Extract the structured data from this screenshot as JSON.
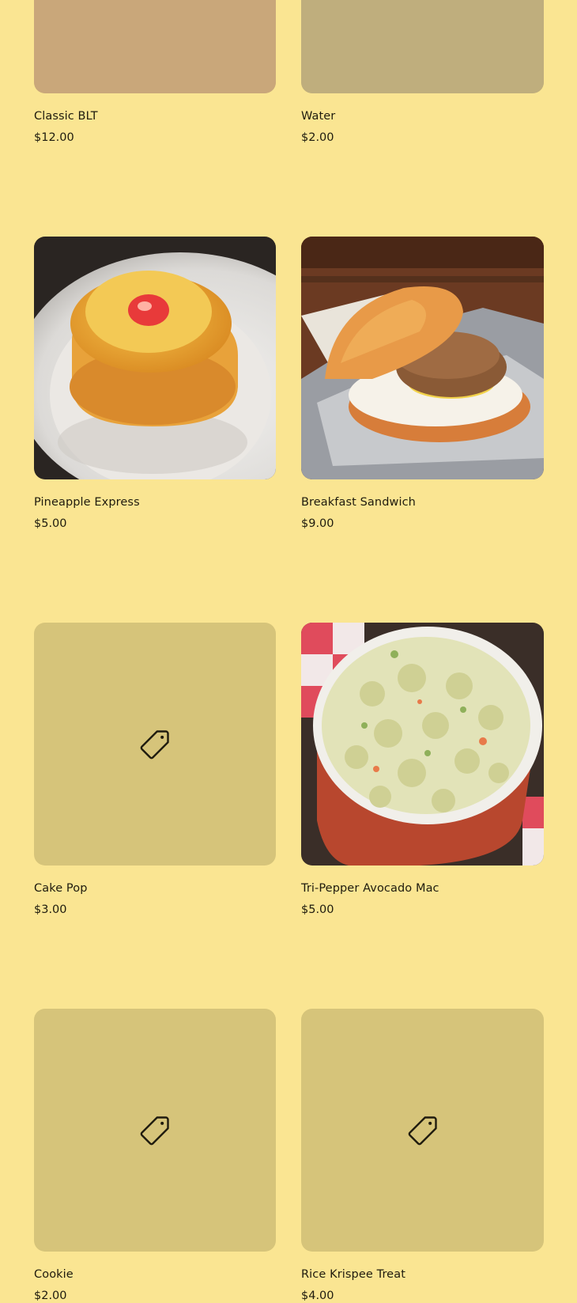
{
  "products": [
    {
      "name": "Classic BLT",
      "price": "$12.00",
      "image": "photo-classic-blt"
    },
    {
      "name": "Water",
      "price": "$2.00",
      "image": "photo-water"
    },
    {
      "name": "Pineapple Express",
      "price": "$5.00",
      "image": "photo-pineapple-cake"
    },
    {
      "name": "Breakfast Sandwich",
      "price": "$9.00",
      "image": "photo-breakfast-sandwich"
    },
    {
      "name": "Cake Pop",
      "price": "$3.00",
      "image": "price-tag-icon"
    },
    {
      "name": "Tri-Pepper Avocado Mac",
      "price": "$5.00",
      "image": "photo-mac-salad"
    },
    {
      "name": "Cookie",
      "price": "$2.00",
      "image": "price-tag-icon"
    },
    {
      "name": "Rice Krispee Treat",
      "price": "$4.00",
      "image": "price-tag-icon"
    }
  ],
  "colors": {
    "page_background": "#fae592",
    "placeholder_background": "#d6c47a",
    "text": "#1f1b0e"
  }
}
